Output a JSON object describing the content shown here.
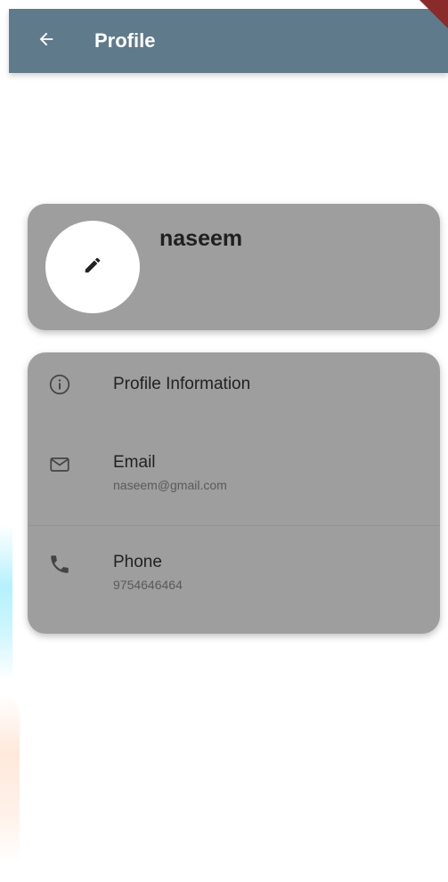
{
  "app_bar": {
    "title": "Profile",
    "back_icon": "arrow-back-icon",
    "background": "#5f7a8b"
  },
  "profile_card": {
    "name": "naseem",
    "avatar_action_icon": "pencil-icon",
    "card_color": "#9e9e9e"
  },
  "info_card": {
    "header": {
      "label": "Profile Information",
      "icon": "info-icon"
    },
    "email": {
      "label": "Email",
      "value": "naseem@gmail.com",
      "icon": "mail-icon"
    },
    "phone": {
      "label": "Phone",
      "value": "9754646464",
      "icon": "phone-icon"
    }
  }
}
